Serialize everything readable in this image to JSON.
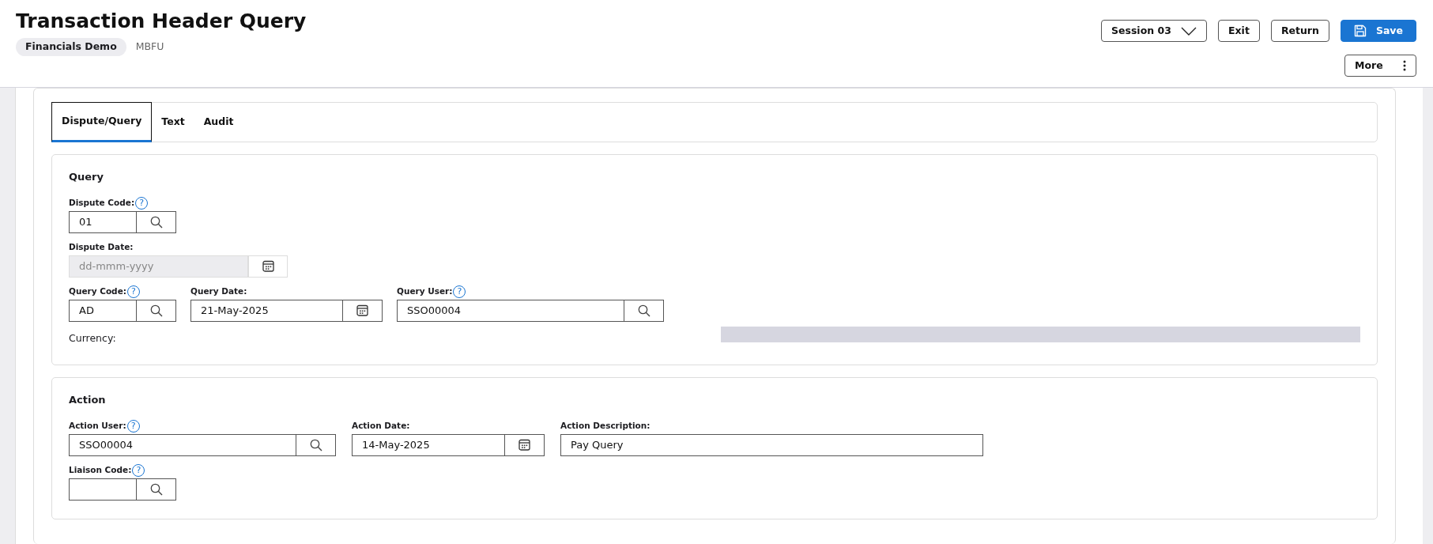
{
  "header": {
    "title": "Transaction Header Query",
    "badge": "Financials Demo",
    "code": "MBFU"
  },
  "session": {
    "label": "Session 03"
  },
  "buttons": [
    {
      "label": "Exit",
      "kind": "outline"
    },
    {
      "label": "Return",
      "kind": "outline"
    },
    {
      "label": "Save",
      "kind": "primary"
    }
  ],
  "more": {
    "label": "More"
  },
  "tabs": [
    {
      "label": "Dispute/Query",
      "selected": true
    },
    {
      "label": "Text",
      "selected": false
    },
    {
      "label": "Audit",
      "selected": false
    }
  ],
  "sections": [
    {
      "title": "Query",
      "rows": [
        [
          {
            "label": "Dispute Code:",
            "help": "?",
            "kind": "lookup",
            "value": "01",
            "disabled": false
          }
        ],
        [
          {
            "label": "Dispute Date:",
            "kind": "date",
            "placeholder": "dd-mmm-yyyy",
            "disabled": true
          }
        ],
        [
          {
            "label": "Query Code:",
            "help": "?",
            "kind": "lookup",
            "value": "AD",
            "disabled": false
          },
          {
            "label": "Query Date:",
            "kind": "date",
            "value": "21-May-2025",
            "disabled": false
          },
          {
            "label": "Query User:",
            "help": "?",
            "kind": "lookup",
            "value": "SSO00004",
            "disabled": false
          }
        ],
        [
          {
            "label": "Currency:",
            "kind": "display"
          }
        ]
      ]
    },
    {
      "title": "Action",
      "rows": [
        [
          {
            "label": "Action User:",
            "help": "?",
            "kind": "lookup",
            "value": "SSO00004",
            "disabled": false
          },
          {
            "label": "Action Date:",
            "kind": "date",
            "value": "14-May-2025",
            "disabled": false
          },
          {
            "label": "Action Description:",
            "kind": "text",
            "value": "Pay Query",
            "disabled": false
          }
        ],
        [
          {
            "label": "Liaison Code:",
            "help": "?",
            "kind": "lookup",
            "disabled": false
          }
        ]
      ]
    }
  ]
}
